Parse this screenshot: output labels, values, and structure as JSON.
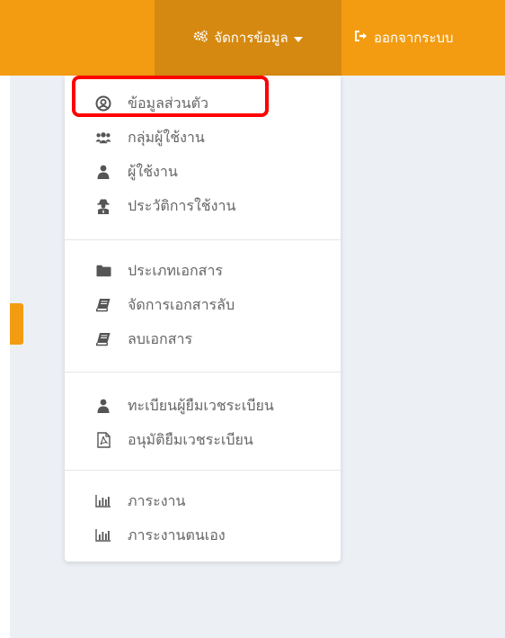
{
  "topnav": {
    "manage_label": "จัดการข้อมูล",
    "manage_icon": "cogs-icon",
    "caret_icon": "caret-down-icon",
    "logout_label": "ออกจากระบบ",
    "logout_icon": "sign-out-icon"
  },
  "dropdown": {
    "groups": [
      {
        "items": [
          {
            "label": "ข้อมูลส่วนตัว",
            "icon": "user-circle-icon",
            "highlighted": true
          },
          {
            "label": "กลุ่มผู้ใช้งาน",
            "icon": "users-icon"
          },
          {
            "label": "ผู้ใช้งาน",
            "icon": "user-icon"
          },
          {
            "label": "ประวัติการใช้งาน",
            "icon": "user-secret-icon"
          }
        ]
      },
      {
        "items": [
          {
            "label": "ประเภทเอกสาร",
            "icon": "folder-icon"
          },
          {
            "label": "จัดการเอกสารลับ",
            "icon": "book-icon"
          },
          {
            "label": "ลบเอกสาร",
            "icon": "book-icon"
          }
        ]
      },
      {
        "items": [
          {
            "label": "ทะเบียนผู้ยืมเวชระเบียน",
            "icon": "user-icon"
          },
          {
            "label": "อนุมัติยืมเวชระเบียน",
            "icon": "file-pdf-icon"
          }
        ]
      },
      {
        "items": [
          {
            "label": "ภาระงาน",
            "icon": "bar-chart-icon"
          },
          {
            "label": "ภาระงานตนเอง",
            "icon": "bar-chart-icon"
          }
        ]
      }
    ]
  },
  "colors": {
    "topbar": "#f39c12",
    "active_nav": "#d68910",
    "content_bg": "#ecf0f5",
    "highlight": "#ff0000"
  }
}
